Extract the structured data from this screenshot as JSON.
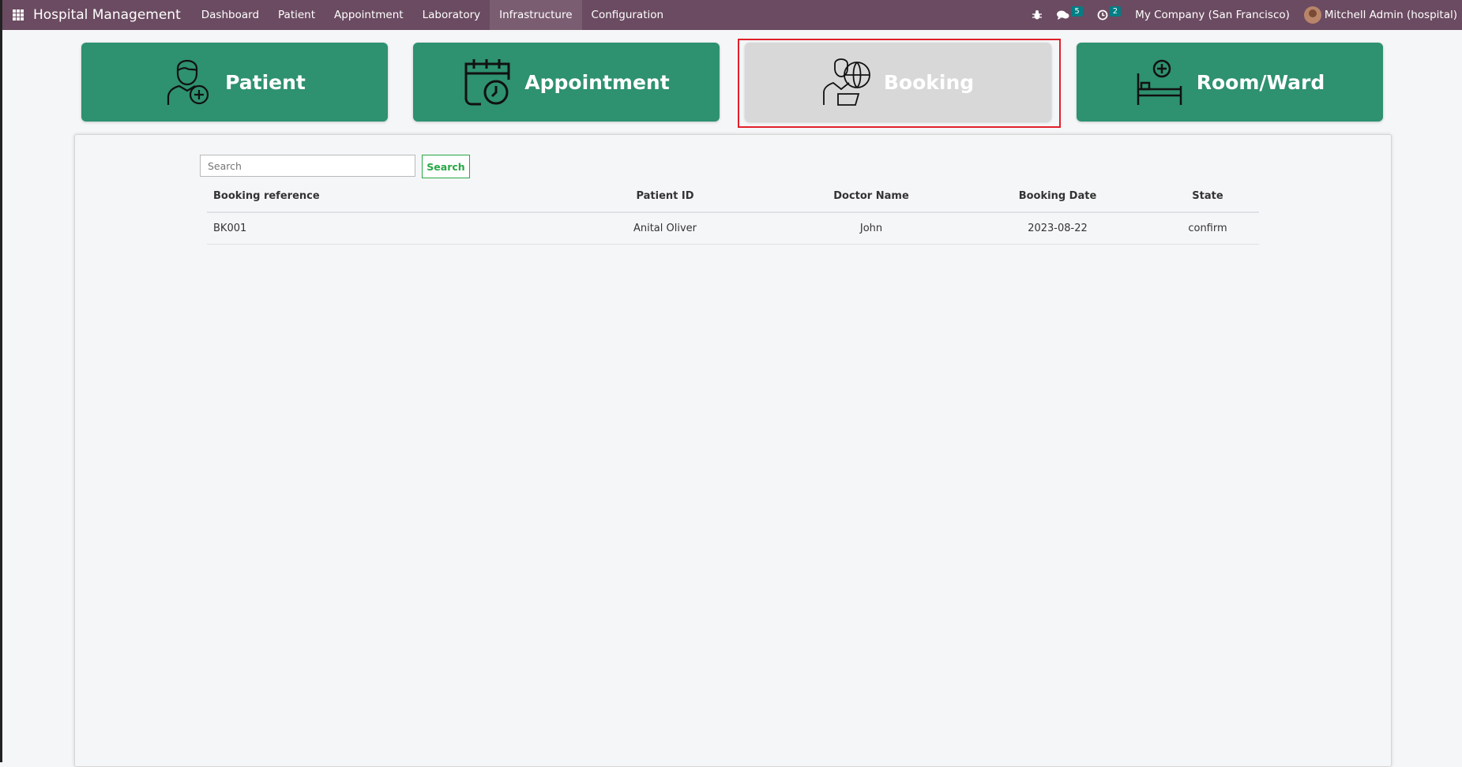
{
  "navbar": {
    "brand": "Hospital Management",
    "menu": [
      "Dashboard",
      "Patient",
      "Appointment",
      "Laboratory",
      "Infrastructure",
      "Configuration"
    ],
    "active_menu": "Infrastructure",
    "messages_count": "5",
    "activities_count": "2",
    "company": "My Company (San Francisco)",
    "user": "Mitchell Admin (hospital)"
  },
  "cards": {
    "patient": "Patient",
    "appointment": "Appointment",
    "booking": "Booking",
    "room": "Room/Ward"
  },
  "search": {
    "placeholder": "Search",
    "button": "Search"
  },
  "table": {
    "headers": [
      "Booking reference",
      "Patient ID",
      "Doctor Name",
      "Booking Date",
      "State"
    ],
    "rows": [
      [
        "BK001",
        "Anital Oliver",
        "John",
        "2023-08-22",
        "confirm"
      ]
    ]
  },
  "colors": {
    "navbar": "#6b4b61",
    "card": "#2e9170",
    "card_selected": "#d8d8d8",
    "highlight": "#e0202a"
  }
}
